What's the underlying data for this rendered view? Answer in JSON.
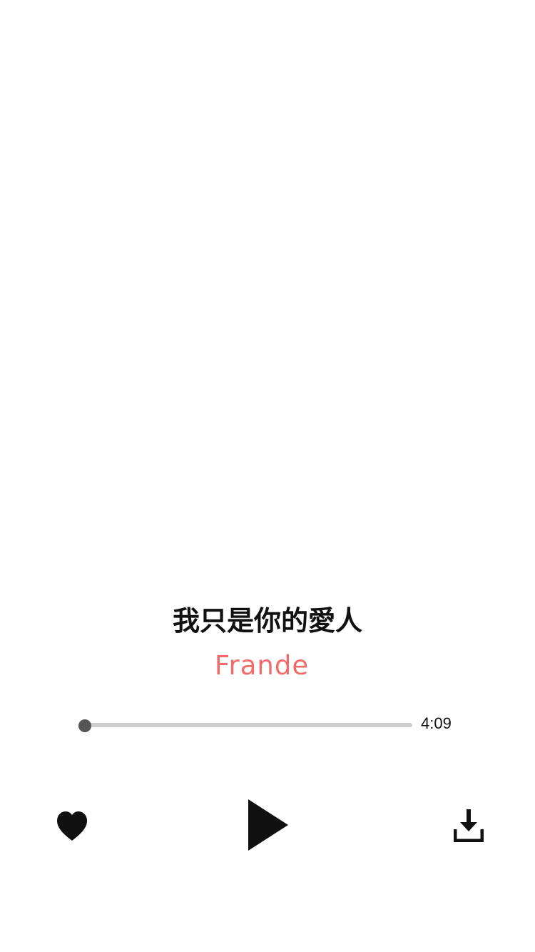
{
  "song": {
    "title": "我只是你的愛人",
    "artist": "Frande"
  },
  "progress": {
    "fraction": 0.0,
    "duration": "4:09"
  },
  "controls": {
    "like_icon": "heart-icon",
    "play_icon": "play-icon",
    "download_icon": "download-icon"
  },
  "colors": {
    "artist": "#f06b6b",
    "track": "#cfcfcf",
    "knob": "#555555",
    "icons": "#111111"
  }
}
